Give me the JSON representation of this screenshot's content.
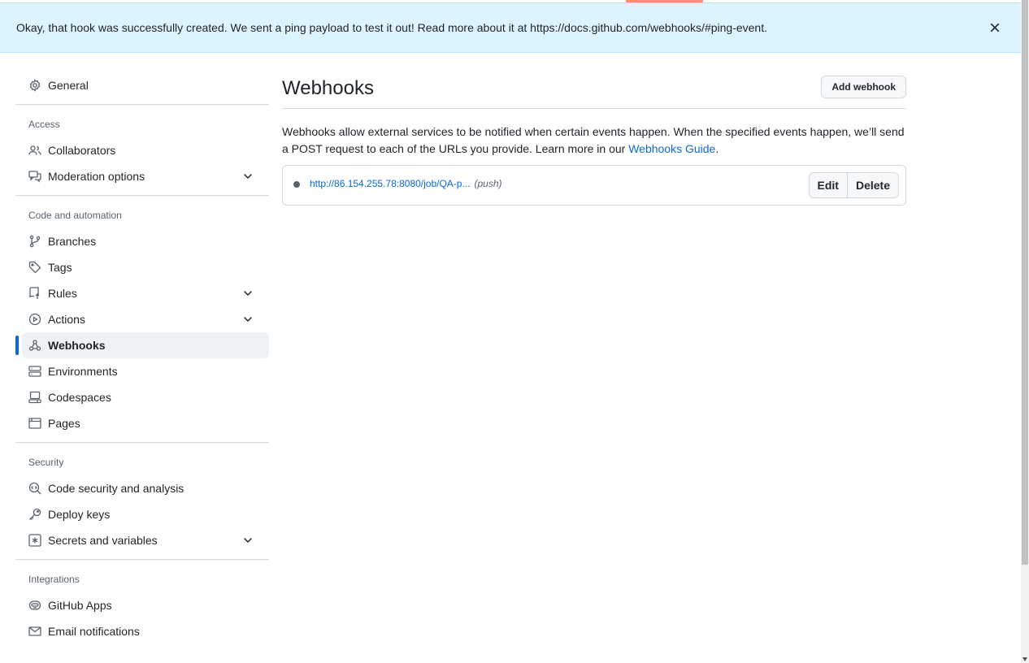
{
  "flash": {
    "message": "Okay, that hook was successfully created. We sent a ping payload to test it out! Read more about it at https://docs.github.com/webhooks/#ping-event.",
    "close_icon": "x-icon"
  },
  "sidebar": {
    "general": {
      "label": "General",
      "icon": "gear-icon"
    },
    "sections": {
      "access": {
        "header": "Access",
        "items": [
          {
            "label": "Collaborators",
            "icon": "people-icon"
          },
          {
            "label": "Moderation options",
            "icon": "comment-discussion-icon",
            "expandable": true
          }
        ]
      },
      "code_automation": {
        "header": "Code and automation",
        "items": [
          {
            "label": "Branches",
            "icon": "git-branch-icon"
          },
          {
            "label": "Tags",
            "icon": "tag-icon"
          },
          {
            "label": "Rules",
            "icon": "repo-push-icon",
            "expandable": true
          },
          {
            "label": "Actions",
            "icon": "play-icon",
            "expandable": true
          },
          {
            "label": "Webhooks",
            "icon": "webhook-icon",
            "active": true
          },
          {
            "label": "Environments",
            "icon": "server-icon"
          },
          {
            "label": "Codespaces",
            "icon": "codespaces-icon"
          },
          {
            "label": "Pages",
            "icon": "browser-icon"
          }
        ]
      },
      "security": {
        "header": "Security",
        "items": [
          {
            "label": "Code security and analysis",
            "icon": "codescan-icon"
          },
          {
            "label": "Deploy keys",
            "icon": "key-icon"
          },
          {
            "label": "Secrets and variables",
            "icon": "key-asterisk-icon",
            "expandable": true
          }
        ]
      },
      "integrations": {
        "header": "Integrations",
        "items": [
          {
            "label": "GitHub Apps",
            "icon": "hubot-icon"
          },
          {
            "label": "Email notifications",
            "icon": "mail-icon"
          }
        ]
      }
    }
  },
  "main": {
    "title": "Webhooks",
    "add_button": "Add webhook",
    "description": "Webhooks allow external services to be notified when certain events happen. When the specified events happen, we’ll send a POST request to each of the URLs you provide. Learn more in our ",
    "guide_link": "Webhooks Guide",
    "description_end": ".",
    "hooks": [
      {
        "url": "http://86.154.255.78:8080/job/QA-p...",
        "event": "(push)",
        "edit_label": "Edit",
        "delete_label": "Delete"
      }
    ]
  },
  "colors": {
    "accent": "#0969da",
    "flash_bg": "#ddf4ff",
    "active_indicator": "#0969da",
    "top_accent": "#fd8c73"
  }
}
